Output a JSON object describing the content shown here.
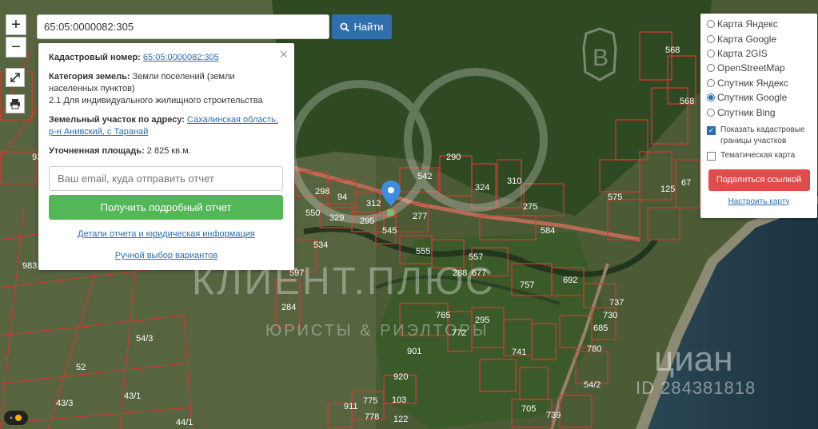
{
  "toolbar": {
    "zoom_in_label": "+",
    "zoom_out_label": "−"
  },
  "search": {
    "value": "65:05:0000082:305",
    "button_label": "Найти"
  },
  "info": {
    "cadastral_label": "Кадастровый номер:",
    "cadastral_value": "65:05:0000082:305",
    "category_label": "Категория земель:",
    "category_value": "Земли поселений (земли населенных пунктов)",
    "usage_value": "2.1 Для индивидуального жилищного строительства",
    "address_label": "Земельный участок по адресу:",
    "address_value": "Сахалинская область, р-н Анивский, с Таранай",
    "area_label": "Уточненная площадь:",
    "area_value": "2 825 кв.м.",
    "email_placeholder": "Ваш email, куда отправить отчет",
    "report_button": "Получить подробный отчет",
    "details_link": "Детали отчета и юридическая информация",
    "manual_link": "Ручной выбор вариантов"
  },
  "layers": {
    "options": [
      "Карта Яндекс",
      "Карта Google",
      "Карта 2GIS",
      "OpenStreetMap",
      "Спутник Яндекс",
      "Спутник Google",
      "Спутник Bing"
    ],
    "selected": "Спутник Google",
    "show_borders_label": "Показать кадастровые границы участков",
    "show_borders_checked": true,
    "thematic_label": "Тематическая карта",
    "thematic_checked": false,
    "share_button": "Поделиться ссылкой",
    "setup_link": "Настроить карту"
  },
  "map_labels": [
    "568",
    "542",
    "290",
    "324",
    "310",
    "298",
    "94",
    "312",
    "550",
    "329",
    "295",
    "277",
    "275",
    "584",
    "545",
    "555",
    "557",
    "534",
    "597",
    "288",
    "677",
    "757",
    "692",
    "737",
    "730",
    "685",
    "780",
    "765",
    "772",
    "295",
    "741",
    "901",
    "920",
    "775",
    "103",
    "778",
    "122",
    "911",
    "705",
    "739",
    "54/2",
    "54/3",
    "52",
    "43/3",
    "43/1",
    "44/1",
    "983",
    "284",
    "575",
    "125",
    "67",
    "568",
    "93"
  ],
  "watermarks": {
    "main": "КЛИЕНТ.ПЛЮС",
    "sub": "ЮРИСТЫ & РИЭЛТОРЫ",
    "cian": "циан",
    "listing_id": "ID 284381818"
  },
  "colors": {
    "parcel_border": "#e0322f",
    "search_button": "#2f6fad",
    "report_button": "#53b757",
    "share_button": "#e04c4c",
    "link": "#2a6db0"
  }
}
